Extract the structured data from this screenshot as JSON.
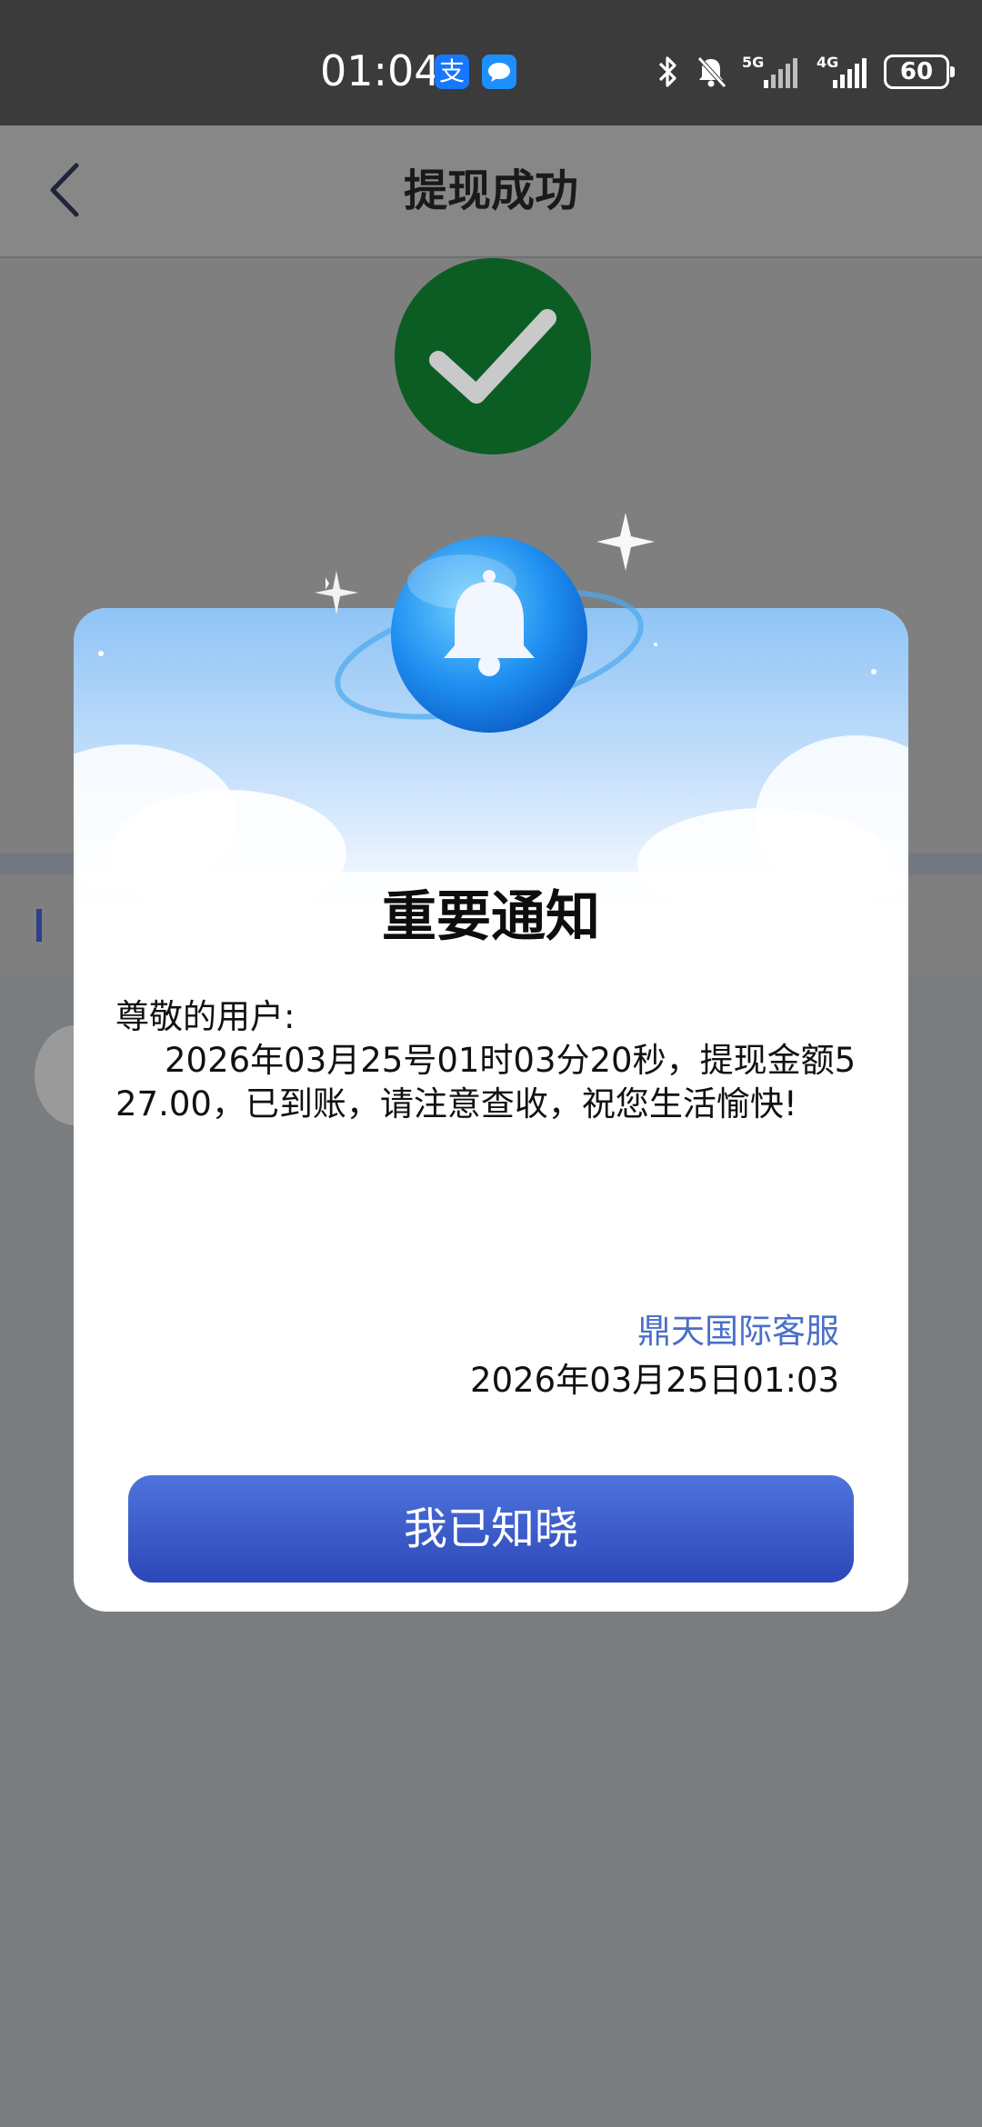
{
  "status_bar": {
    "time": "01:04",
    "alipay_icon_label": "支",
    "battery_level": "60",
    "network_5g": "5G",
    "network_4g": "4G"
  },
  "nav": {
    "title": "提现成功"
  },
  "modal": {
    "title": "重要通知",
    "greeting": "尊敬的用户:",
    "message": "2026年03月25号01时03分20秒，提现金额527.00，已到账，请注意查收，祝您生活愉快!",
    "signature": "鼎天国际客服",
    "date": "2026年03月25日01:03",
    "confirm_label": "我已知晓"
  },
  "colors": {
    "status_bar": "#3b3b3b",
    "overlay": "#7a7d80",
    "success_green": "#0b5d24",
    "signature_blue": "#4a6fc9",
    "button_top": "#4e74dc",
    "button_bottom": "#2d47b8"
  }
}
